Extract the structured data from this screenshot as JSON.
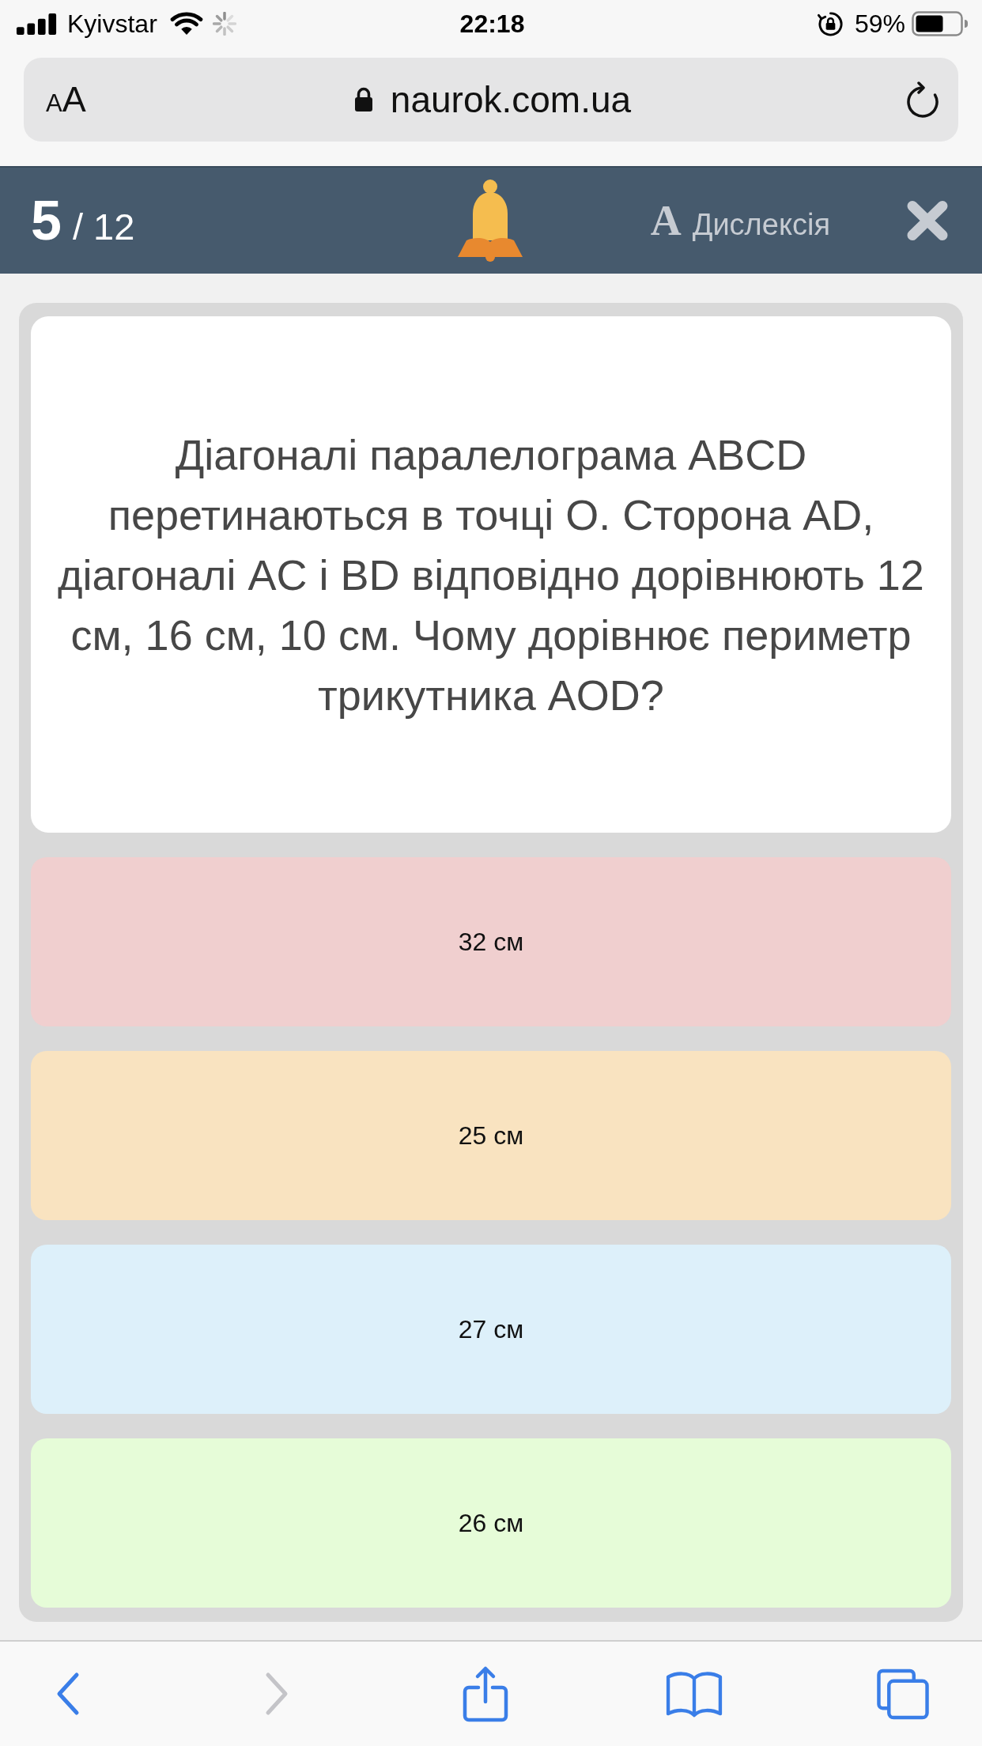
{
  "status_bar": {
    "carrier": "Kyivstar",
    "time": "22:18",
    "battery": "59%"
  },
  "address_bar": {
    "text_size_button": {
      "small": "A",
      "large": "A"
    },
    "url": "naurok.com.ua"
  },
  "quiz_header": {
    "current": "5",
    "total": "/ 12",
    "dyslexia_button": {
      "glyph": "A",
      "label": "Дислексія"
    }
  },
  "question": {
    "text": "Діагоналі паралелограма ABCD перетинаються в точці О. Сторона AD, діагоналі AC і BD відповідно дорівнюють 12 см, 16 см, 10 см. Чому дорівнює периметр трикутника AOD?"
  },
  "answers": [
    {
      "label": "32 см",
      "color": "#f0cfcf",
      "selected": false
    },
    {
      "label": "25 см",
      "color": "#f9e3c0",
      "selected": false
    },
    {
      "label": "27 см",
      "color": "#ddf0fa",
      "selected": false
    },
    {
      "label": "26 см",
      "color": "#e6fcd8",
      "selected": false
    }
  ],
  "toolbar": {
    "buttons": [
      {
        "kind": "back",
        "disabled": false
      },
      {
        "kind": "forward",
        "disabled": true
      },
      {
        "kind": "share",
        "disabled": false
      },
      {
        "kind": "bookmarks",
        "disabled": false
      },
      {
        "kind": "tabs",
        "disabled": false
      }
    ]
  }
}
